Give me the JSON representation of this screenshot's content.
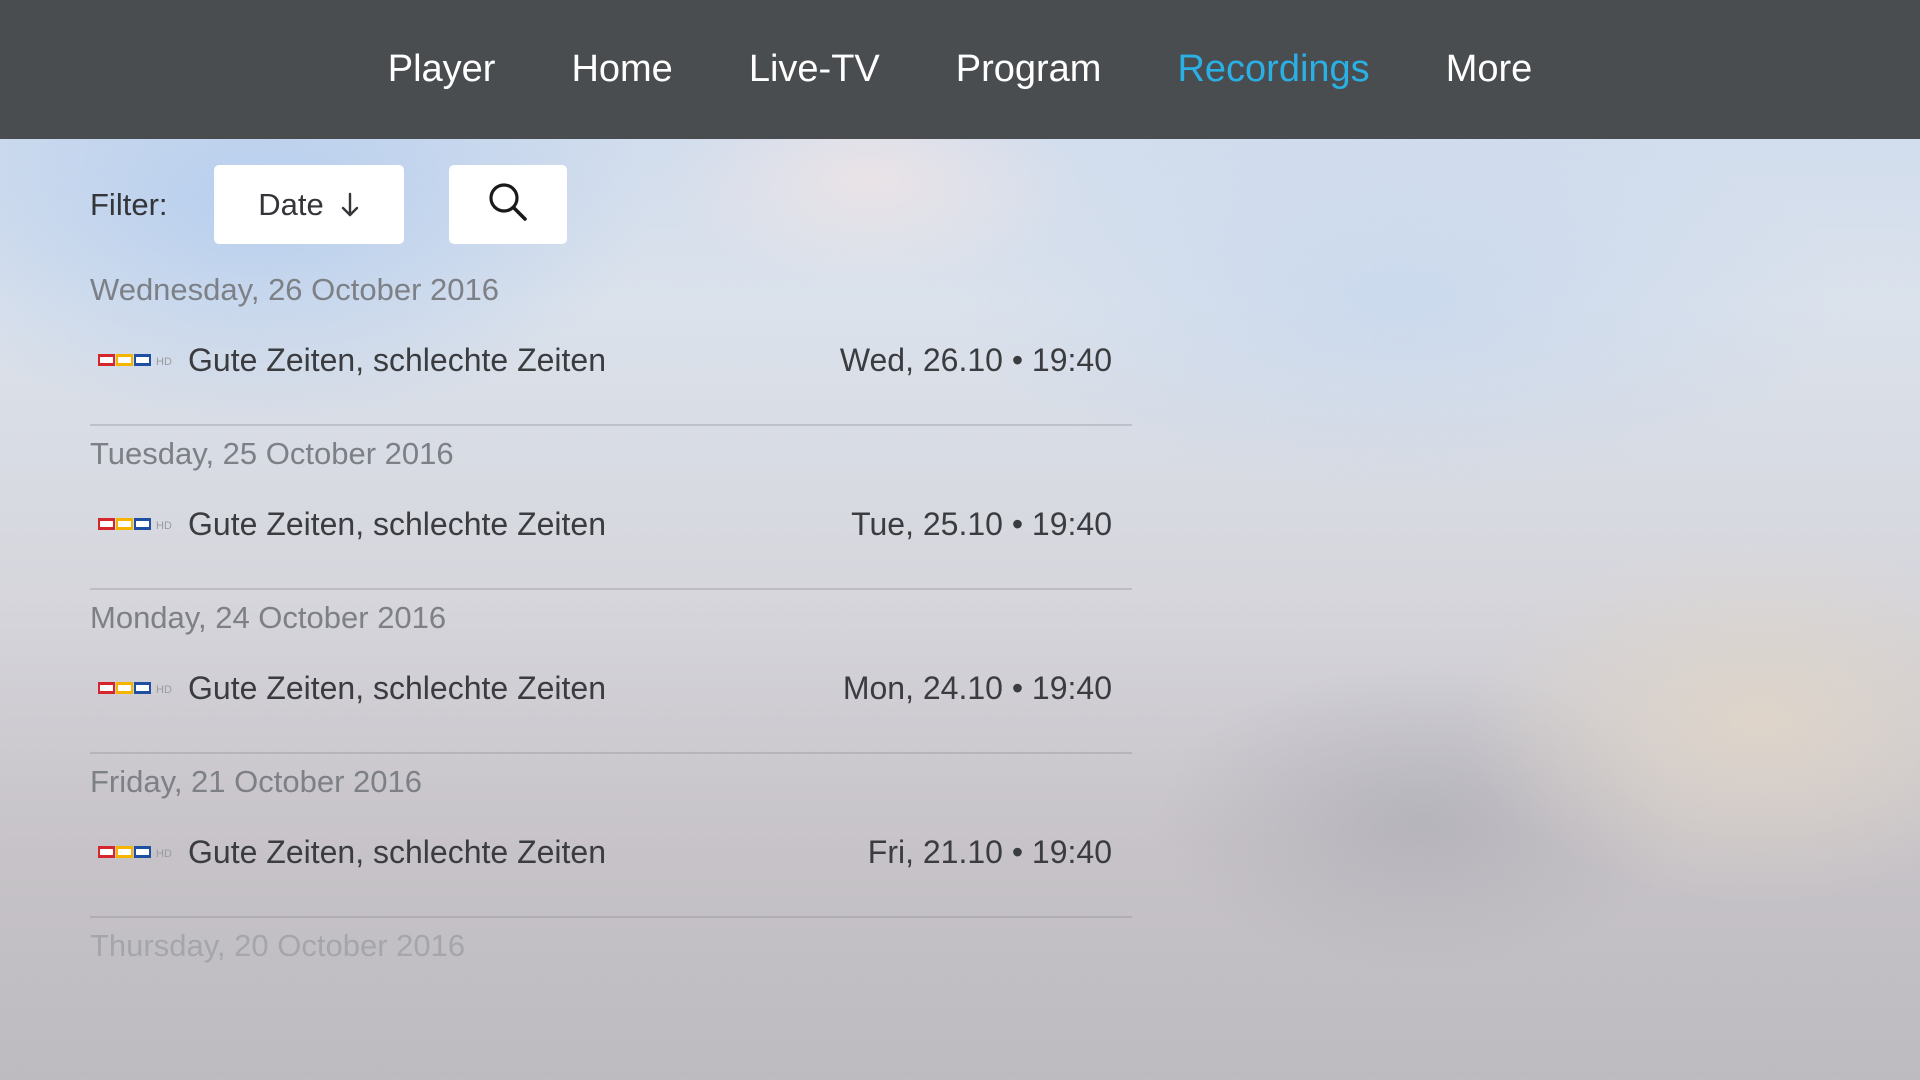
{
  "nav": {
    "items": [
      {
        "label": "Player",
        "active": false
      },
      {
        "label": "Home",
        "active": false
      },
      {
        "label": "Live-TV",
        "active": false
      },
      {
        "label": "Program",
        "active": false
      },
      {
        "label": "Recordings",
        "active": true
      },
      {
        "label": "More",
        "active": false
      }
    ],
    "active_color": "#2ab0e4"
  },
  "filter": {
    "label": "Filter:",
    "sort_button_label": "Date",
    "sort_icon": "arrow-down-icon",
    "search_icon": "search-icon"
  },
  "recordings": [
    {
      "date_header": "Wednesday, 26 October 2016",
      "channel_logo": "RTL",
      "channel_suffix": "HD",
      "title": "Gute Zeiten, schlechte Zeiten",
      "time": "Wed, 26.10 • 19:40"
    },
    {
      "date_header": "Tuesday, 25 October 2016",
      "channel_logo": "RTL",
      "channel_suffix": "HD",
      "title": "Gute Zeiten, schlechte Zeiten",
      "time": "Tue, 25.10 • 19:40"
    },
    {
      "date_header": "Monday, 24 October 2016",
      "channel_logo": "RTL",
      "channel_suffix": "HD",
      "title": "Gute Zeiten, schlechte Zeiten",
      "time": "Mon, 24.10 • 19:40"
    },
    {
      "date_header": "Friday, 21 October 2016",
      "channel_logo": "RTL",
      "channel_suffix": "HD",
      "title": "Gute Zeiten, schlechte Zeiten",
      "time": "Fri, 21.10 • 19:40"
    }
  ],
  "partial_group": {
    "date_header": "Thursday, 20 October 2016"
  },
  "colors": {
    "topbar": "#4a4d50",
    "rtl_red": "#d6262b",
    "rtl_yellow": "#f4b400",
    "rtl_blue": "#1f4fa3"
  }
}
